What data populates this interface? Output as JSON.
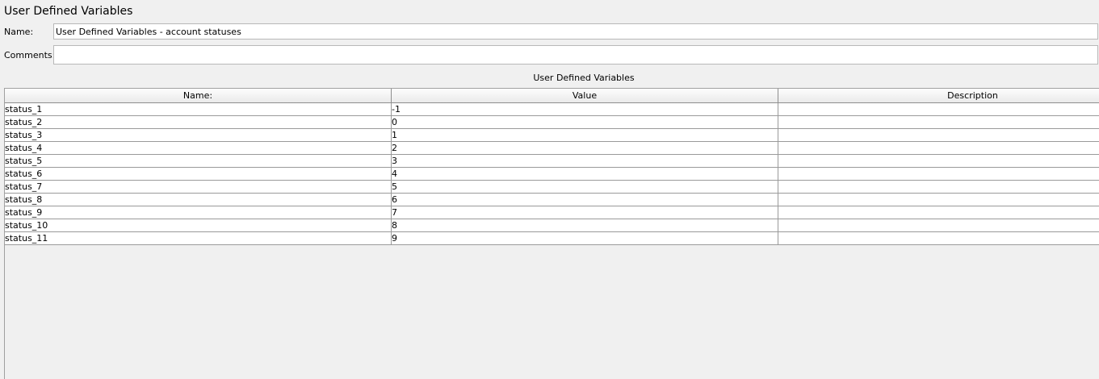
{
  "panel": {
    "title": "User Defined Variables"
  },
  "form": {
    "name_label": "Name:",
    "name_value": "User Defined Variables - account statuses",
    "comments_label": "Comments:",
    "comments_value": ""
  },
  "table": {
    "caption": "User Defined Variables",
    "columns": [
      "Name:",
      "Value",
      "Description"
    ],
    "rows": [
      {
        "name": "status_1",
        "value": "-1",
        "description": ""
      },
      {
        "name": "status_2",
        "value": "0",
        "description": ""
      },
      {
        "name": "status_3",
        "value": "1",
        "description": ""
      },
      {
        "name": "status_4",
        "value": "2",
        "description": ""
      },
      {
        "name": "status_5",
        "value": "3",
        "description": ""
      },
      {
        "name": "status_6",
        "value": "4",
        "description": ""
      },
      {
        "name": "status_7",
        "value": "5",
        "description": ""
      },
      {
        "name": "status_8",
        "value": "6",
        "description": ""
      },
      {
        "name": "status_9",
        "value": "7",
        "description": ""
      },
      {
        "name": "status_10",
        "value": "8",
        "description": ""
      },
      {
        "name": "status_11",
        "value": "9",
        "description": ""
      }
    ]
  }
}
